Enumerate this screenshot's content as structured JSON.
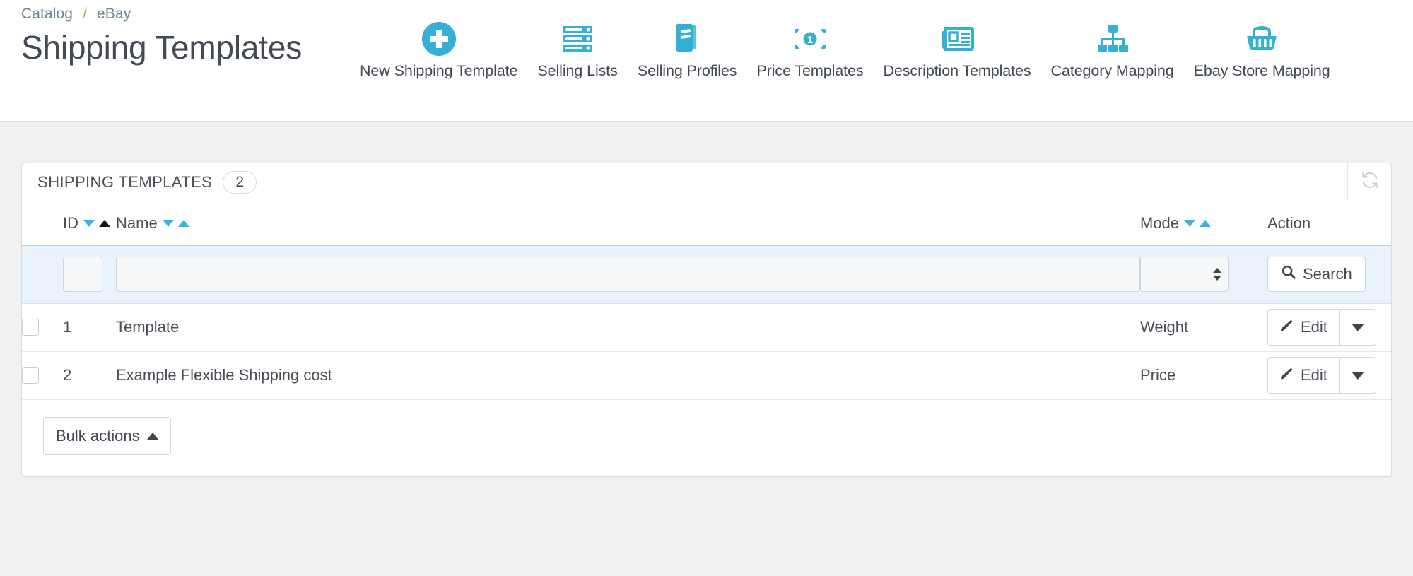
{
  "breadcrumb": {
    "items": [
      "Catalog",
      "eBay"
    ],
    "separator": "/"
  },
  "page_title": "Shipping Templates",
  "colors": {
    "accent": "#33b5e5",
    "breadcrumb_sep": "#8bc34a",
    "filter_row_bg": "#eaf2fb",
    "text": "#434a54"
  },
  "toolbar": {
    "items": [
      {
        "label": "New Shipping Template",
        "icon": "plus-circle-icon"
      },
      {
        "label": "Selling Lists",
        "icon": "server-list-icon"
      },
      {
        "label": "Selling Profiles",
        "icon": "book-icon"
      },
      {
        "label": "Price Templates",
        "icon": "banknote-icon"
      },
      {
        "label": "Description Templates",
        "icon": "newspaper-icon"
      },
      {
        "label": "Category Mapping",
        "icon": "sitemap-icon"
      },
      {
        "label": "Ebay Store Mapping",
        "icon": "basket-icon"
      }
    ]
  },
  "panel": {
    "title": "SHIPPING TEMPLATES",
    "count": "2",
    "refresh_icon": "refresh-icon"
  },
  "table": {
    "headers": {
      "id": "ID",
      "name": "Name",
      "mode": "Mode",
      "action": "Action"
    },
    "sort": {
      "active_column": "ID",
      "active_direction": "asc"
    },
    "filters": {
      "id_value": "",
      "name_value": "",
      "mode_value": "",
      "search_label": "Search",
      "search_icon": "search-icon"
    },
    "rows": [
      {
        "checked": false,
        "id": "1",
        "name": "Template",
        "mode": "Weight",
        "action_label": "Edit",
        "action_icon": "pencil-icon"
      },
      {
        "checked": false,
        "id": "2",
        "name": "Example Flexible Shipping cost",
        "mode": "Price",
        "action_label": "Edit",
        "action_icon": "pencil-icon"
      }
    ]
  },
  "footer": {
    "bulk_actions_label": "Bulk actions",
    "bulk_actions_icon": "caret-up-icon"
  }
}
